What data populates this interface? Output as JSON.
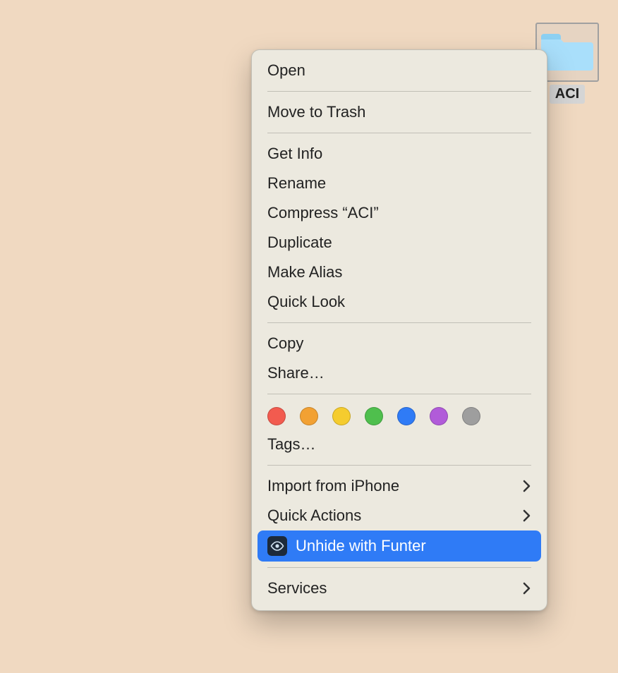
{
  "folder": {
    "name": "ACI"
  },
  "menu": {
    "open": "Open",
    "move_to_trash": "Move to Trash",
    "get_info": "Get Info",
    "rename": "Rename",
    "compress": "Compress “ACI”",
    "duplicate": "Duplicate",
    "make_alias": "Make Alias",
    "quick_look": "Quick Look",
    "copy": "Copy",
    "share": "Share…",
    "tags": "Tags…",
    "import_from_iphone": "Import from iPhone",
    "quick_actions": "Quick Actions",
    "unhide_with_funter": "Unhide with Funter",
    "services": "Services"
  },
  "tag_colors": {
    "red": "#f25b4f",
    "orange": "#f2a133",
    "yellow": "#f5cc2e",
    "green": "#4fbf4d",
    "blue": "#2f7bf6",
    "purple": "#b15bd9",
    "gray": "#9e9e9e"
  }
}
